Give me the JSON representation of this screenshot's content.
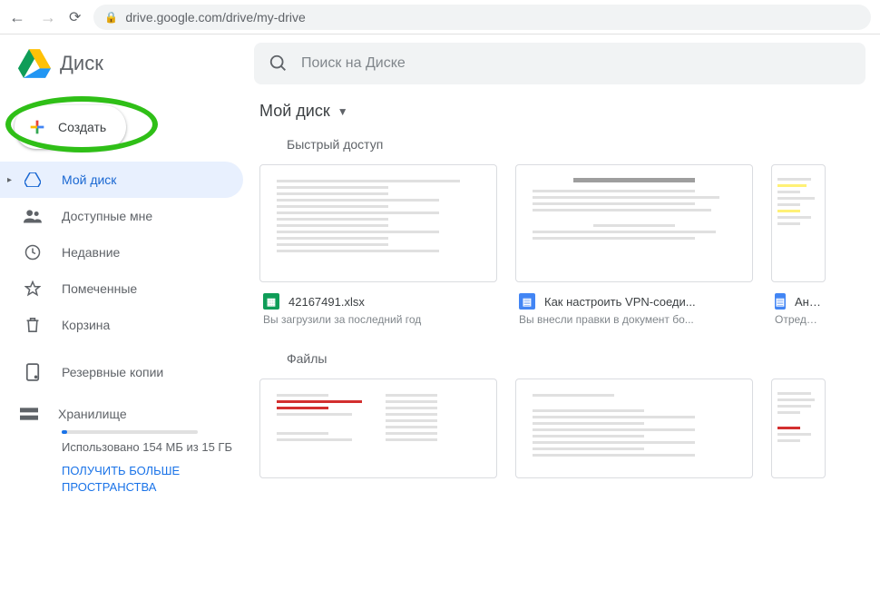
{
  "browser": {
    "url": "drive.google.com/drive/my-drive"
  },
  "app": {
    "title": "Диск",
    "search_placeholder": "Поиск на Диске"
  },
  "sidebar": {
    "create_label": "Создать",
    "items": [
      {
        "label": "Мой диск",
        "icon": "drive"
      },
      {
        "label": "Доступные мне",
        "icon": "shared"
      },
      {
        "label": "Недавние",
        "icon": "recent"
      },
      {
        "label": "Помеченные",
        "icon": "star"
      },
      {
        "label": "Корзина",
        "icon": "trash"
      }
    ],
    "backups_label": "Резервные копии",
    "storage_label": "Хранилище",
    "storage_used_text": "Использовано 154 МБ из 15 ГБ",
    "storage_link": "ПОЛУЧИТЬ БОЛЬШЕ ПРОСТРАНСТВА"
  },
  "main": {
    "breadcrumb": "Мой диск",
    "quick_title": "Быстрый доступ",
    "files_title": "Файлы",
    "quick": [
      {
        "name": "42167491.xlsx",
        "sub": "Вы загрузили за последний год",
        "type": "sheets"
      },
      {
        "name": "Как настроить VPN-соеди...",
        "sub": "Вы внесли правки в документ бо...",
        "type": "docs"
      },
      {
        "name": "Андрои",
        "sub": "Отредактиро",
        "type": "docs"
      }
    ]
  }
}
